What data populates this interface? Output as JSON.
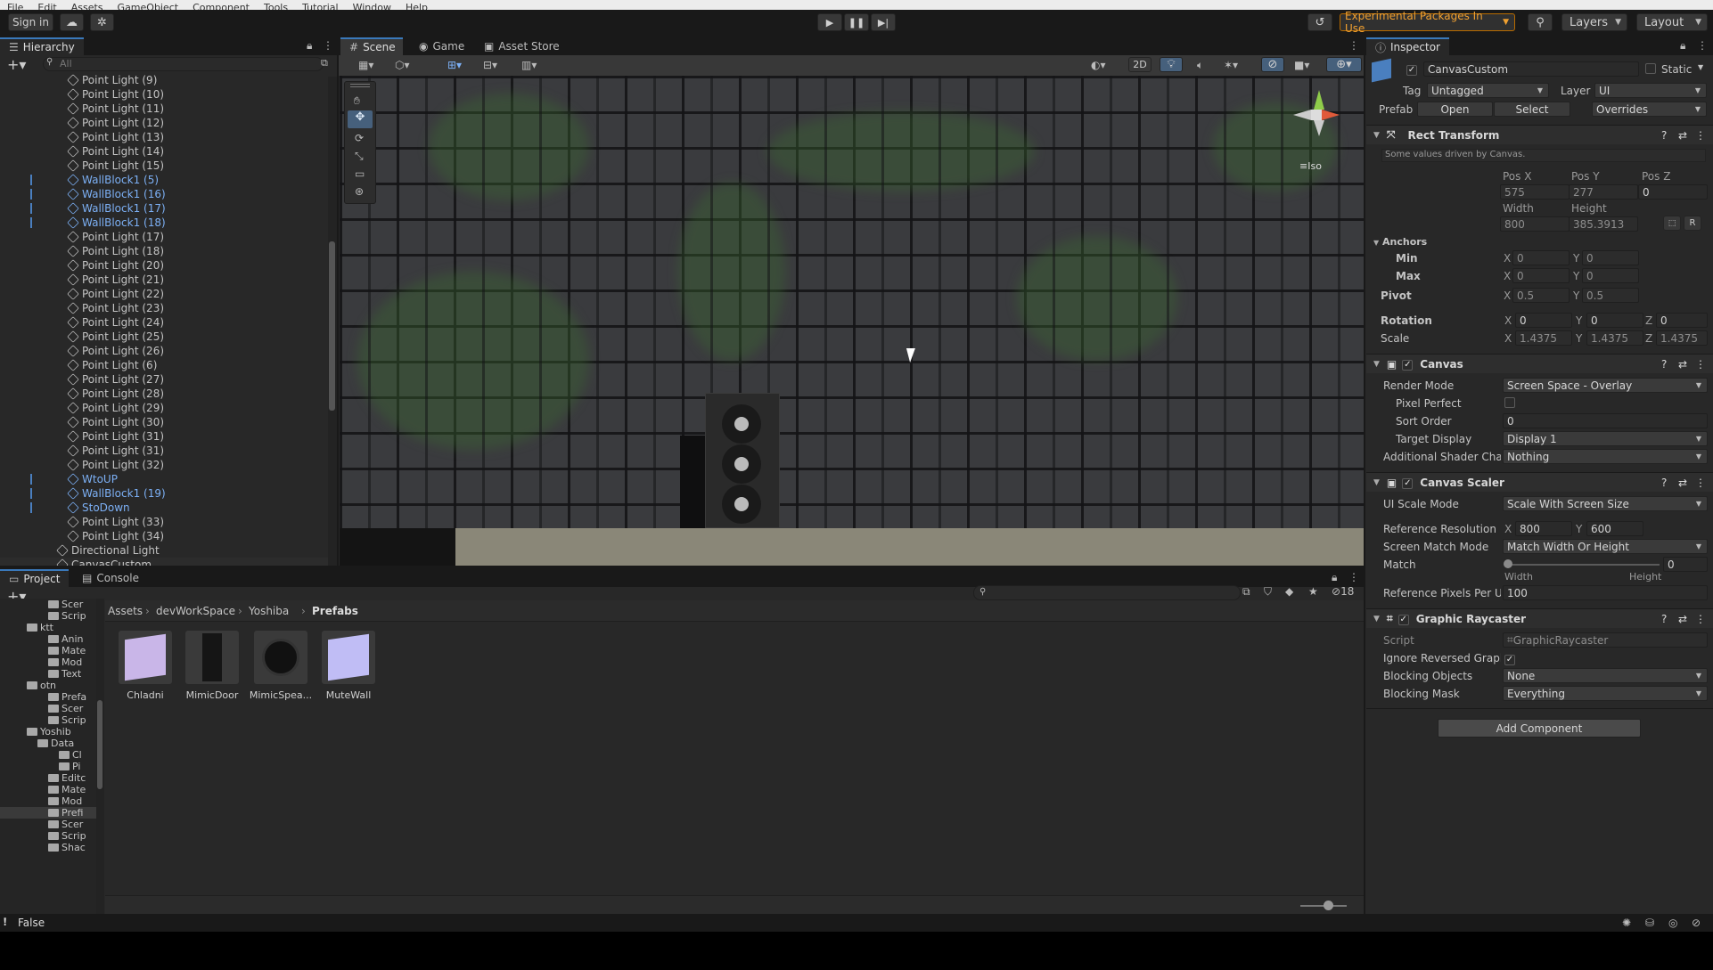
{
  "menu": [
    "File",
    "Edit",
    "Assets",
    "GameObject",
    "Component",
    "Tools",
    "Tutorial",
    "Window",
    "Help"
  ],
  "toolbar": {
    "sign_in": "Sign in",
    "experimental": "Experimental Packages In Use",
    "layers": "Layers",
    "layout": "Layout"
  },
  "hierarchy": {
    "tab": "Hierarchy",
    "search_placeholder": "All",
    "items": [
      {
        "label": "Point Light (9)",
        "blue": false,
        "indent": 2
      },
      {
        "label": "Point Light (10)",
        "blue": false,
        "indent": 2
      },
      {
        "label": "Point Light (11)",
        "blue": false,
        "indent": 2
      },
      {
        "label": "Point Light (12)",
        "blue": false,
        "indent": 2
      },
      {
        "label": "Point Light (13)",
        "blue": false,
        "indent": 2
      },
      {
        "label": "Point Light (14)",
        "blue": false,
        "indent": 2
      },
      {
        "label": "Point Light (15)",
        "blue": false,
        "indent": 2
      },
      {
        "label": "WallBlock1 (5)",
        "blue": true,
        "indent": 2
      },
      {
        "label": "WallBlock1 (16)",
        "blue": true,
        "indent": 2
      },
      {
        "label": "WallBlock1 (17)",
        "blue": true,
        "indent": 2
      },
      {
        "label": "WallBlock1 (18)",
        "blue": true,
        "indent": 2
      },
      {
        "label": "Point Light (17)",
        "blue": false,
        "indent": 2
      },
      {
        "label": "Point Light (18)",
        "blue": false,
        "indent": 2
      },
      {
        "label": "Point Light (20)",
        "blue": false,
        "indent": 2
      },
      {
        "label": "Point Light (21)",
        "blue": false,
        "indent": 2
      },
      {
        "label": "Point Light (22)",
        "blue": false,
        "indent": 2
      },
      {
        "label": "Point Light (23)",
        "blue": false,
        "indent": 2
      },
      {
        "label": "Point Light (24)",
        "blue": false,
        "indent": 2
      },
      {
        "label": "Point Light (25)",
        "blue": false,
        "indent": 2
      },
      {
        "label": "Point Light (26)",
        "blue": false,
        "indent": 2
      },
      {
        "label": "Point Light (6)",
        "blue": false,
        "indent": 2
      },
      {
        "label": "Point Light (27)",
        "blue": false,
        "indent": 2
      },
      {
        "label": "Point Light (28)",
        "blue": false,
        "indent": 2
      },
      {
        "label": "Point Light (29)",
        "blue": false,
        "indent": 2
      },
      {
        "label": "Point Light (30)",
        "blue": false,
        "indent": 2
      },
      {
        "label": "Point Light (31)",
        "blue": false,
        "indent": 2
      },
      {
        "label": "Point Light (31)",
        "blue": false,
        "indent": 2
      },
      {
        "label": "Point Light (32)",
        "blue": false,
        "indent": 2
      },
      {
        "label": "WtoUP",
        "blue": true,
        "indent": 2
      },
      {
        "label": "WallBlock1 (19)",
        "blue": true,
        "indent": 2
      },
      {
        "label": "StoDown",
        "blue": true,
        "indent": 2
      },
      {
        "label": "Point Light (33)",
        "blue": false,
        "indent": 2
      },
      {
        "label": "Point Light (34)",
        "blue": false,
        "indent": 2
      },
      {
        "label": "Directional Light",
        "blue": false,
        "indent": 1
      },
      {
        "label": "CanvasCustom",
        "blue": false,
        "indent": 1
      }
    ]
  },
  "scene": {
    "tabs": [
      "Scene",
      "Game",
      "Asset Store"
    ],
    "btn_2d": "2D",
    "iso": "Iso"
  },
  "project": {
    "tabs": [
      "Project",
      "Console"
    ],
    "breadcrumb": [
      "Assets",
      "devWorkSpace",
      "Yoshiba",
      "Prefabs"
    ],
    "hidden_count": "18",
    "tree": [
      {
        "label": "Scer",
        "indent": 3
      },
      {
        "label": "Scrip",
        "indent": 3
      },
      {
        "label": "ktt",
        "indent": 1
      },
      {
        "label": "Anin",
        "indent": 3
      },
      {
        "label": "Mate",
        "indent": 3
      },
      {
        "label": "Mod",
        "indent": 3
      },
      {
        "label": "Text",
        "indent": 3
      },
      {
        "label": "otn",
        "indent": 1
      },
      {
        "label": "Prefa",
        "indent": 3
      },
      {
        "label": "Scer",
        "indent": 3
      },
      {
        "label": "Scrip",
        "indent": 3
      },
      {
        "label": "Yoshib",
        "indent": 1
      },
      {
        "label": "Data",
        "indent": 2
      },
      {
        "label": "Cl",
        "indent": 4
      },
      {
        "label": "Pi",
        "indent": 4
      },
      {
        "label": "Editc",
        "indent": 3
      },
      {
        "label": "Mate",
        "indent": 3
      },
      {
        "label": "Mod",
        "indent": 3
      },
      {
        "label": "Prefi",
        "indent": 3
      },
      {
        "label": "Scer",
        "indent": 3
      },
      {
        "label": "Scrip",
        "indent": 3
      },
      {
        "label": "Shac",
        "indent": 3
      }
    ],
    "assets": [
      "Chladni",
      "MimicDoor",
      "MimicSpea...",
      "MuteWall"
    ]
  },
  "inspector": {
    "tab": "Inspector",
    "object_name": "CanvasCustom",
    "static": "Static",
    "tag_label": "Tag",
    "tag": "Untagged",
    "layer_label": "Layer",
    "layer": "UI",
    "prefab_label": "Prefab",
    "open": "Open",
    "select": "Select",
    "overrides": "Overrides",
    "rect": {
      "title": "Rect Transform",
      "note": "Some values driven by Canvas.",
      "posx_label": "Pos X",
      "posy_label": "Pos Y",
      "posz_label": "Pos Z",
      "posx": "575",
      "posy": "277",
      "posz": "0",
      "width_label": "Width",
      "height_label": "Height",
      "width": "800",
      "height": "385.3913",
      "anchors": "Anchors",
      "min": "Min",
      "max": "Max",
      "min_x": "0",
      "min_y": "0",
      "max_x": "0",
      "max_y": "0",
      "pivot": "Pivot",
      "pivot_x": "0.5",
      "pivot_y": "0.5",
      "rotation": "Rotation",
      "rot_x": "0",
      "rot_y": "0",
      "rot_z": "0",
      "scale": "Scale",
      "scale_x": "1.4375",
      "scale_y": "1.4375",
      "scale_z": "1.4375",
      "r_btn": "R"
    },
    "canvas": {
      "title": "Canvas",
      "render_mode_label": "Render Mode",
      "render_mode": "Screen Space - Overlay",
      "pixel_perfect": "Pixel Perfect",
      "sort_order_label": "Sort Order",
      "sort_order": "0",
      "target_display_label": "Target Display",
      "target_display": "Display 1",
      "shader_label": "Additional Shader Chani",
      "shader": "Nothing"
    },
    "scaler": {
      "title": "Canvas Scaler",
      "mode_label": "UI Scale Mode",
      "mode": "Scale With Screen Size",
      "ref_label": "Reference Resolution",
      "ref_x": "800",
      "ref_y": "600",
      "match_mode_label": "Screen Match Mode",
      "match_mode": "Match Width Or Height",
      "match_label": "Match",
      "match": "0",
      "width": "Width",
      "height": "Height",
      "ppu_label": "Reference Pixels Per Un",
      "ppu": "100"
    },
    "raycaster": {
      "title": "Graphic Raycaster",
      "script_label": "Script",
      "script": "GraphicRaycaster",
      "ignore_label": "Ignore Reversed Graphic",
      "blocking_label": "Blocking Objects",
      "blocking": "None",
      "mask_label": "Blocking Mask",
      "mask": "Everything"
    },
    "add_component": "Add Component"
  },
  "status": {
    "text": "False"
  },
  "xyz": {
    "x": "X",
    "y": "Y",
    "z": "Z"
  }
}
